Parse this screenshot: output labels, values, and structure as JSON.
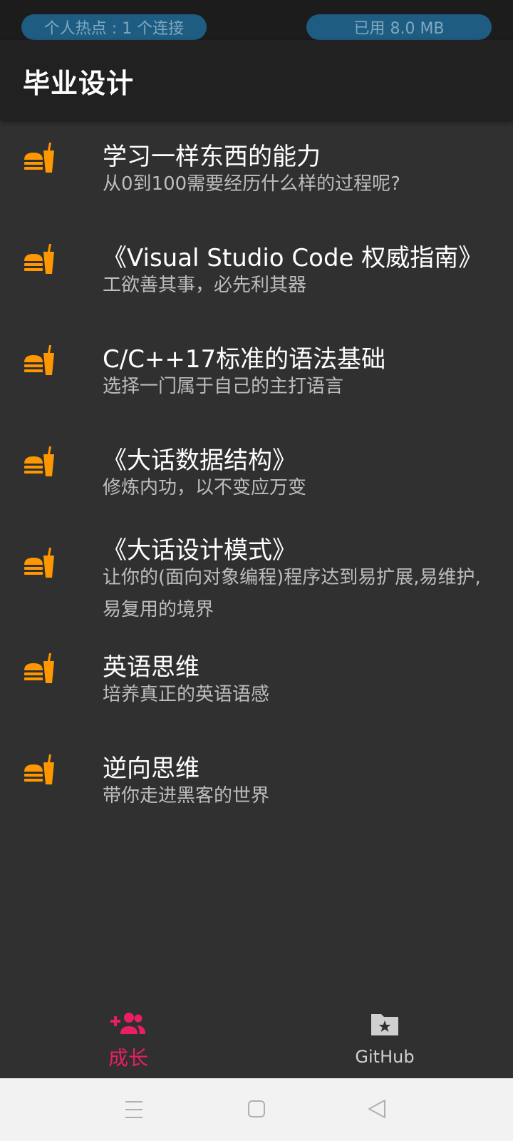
{
  "status_bar": {
    "hotspot_text": "个人热点 : 1 个连接",
    "data_used_text": "已用 8.0 MB"
  },
  "app_bar": {
    "title": "毕业设计"
  },
  "list": {
    "icon": "fastfood-icon",
    "icon_color": "#ff9800",
    "items": [
      {
        "title": "学习一样东西的能力",
        "subtitle": "从0到100需要经历什么样的过程呢?"
      },
      {
        "title": "《Visual Studio Code 权威指南》",
        "subtitle": "工欲善其事，必先利其器"
      },
      {
        "title": "C/C++17标准的语法基础",
        "subtitle": "选择一门属于自己的主打语言"
      },
      {
        "title": "《大话数据结构》",
        "subtitle": "修炼内功，以不变应万变"
      },
      {
        "title": "《大话设计模式》",
        "subtitle": "让你的(面向对象编程)程序达到易扩展,易维护,易复用的境界"
      },
      {
        "title": "英语思维",
        "subtitle": "培养真正的英语语感"
      },
      {
        "title": "逆向思维",
        "subtitle": "带你走进黑客的世界"
      }
    ]
  },
  "bottom_nav": {
    "tabs": [
      {
        "label": "成长",
        "icon": "group-add-icon",
        "selected": true,
        "color": "#e91e63"
      },
      {
        "label": "GitHub",
        "icon": "folder-star-icon",
        "selected": false,
        "color": "#d0d0d0"
      }
    ]
  },
  "system_nav": {
    "buttons": [
      "menu-icon",
      "home-icon",
      "back-icon"
    ]
  }
}
